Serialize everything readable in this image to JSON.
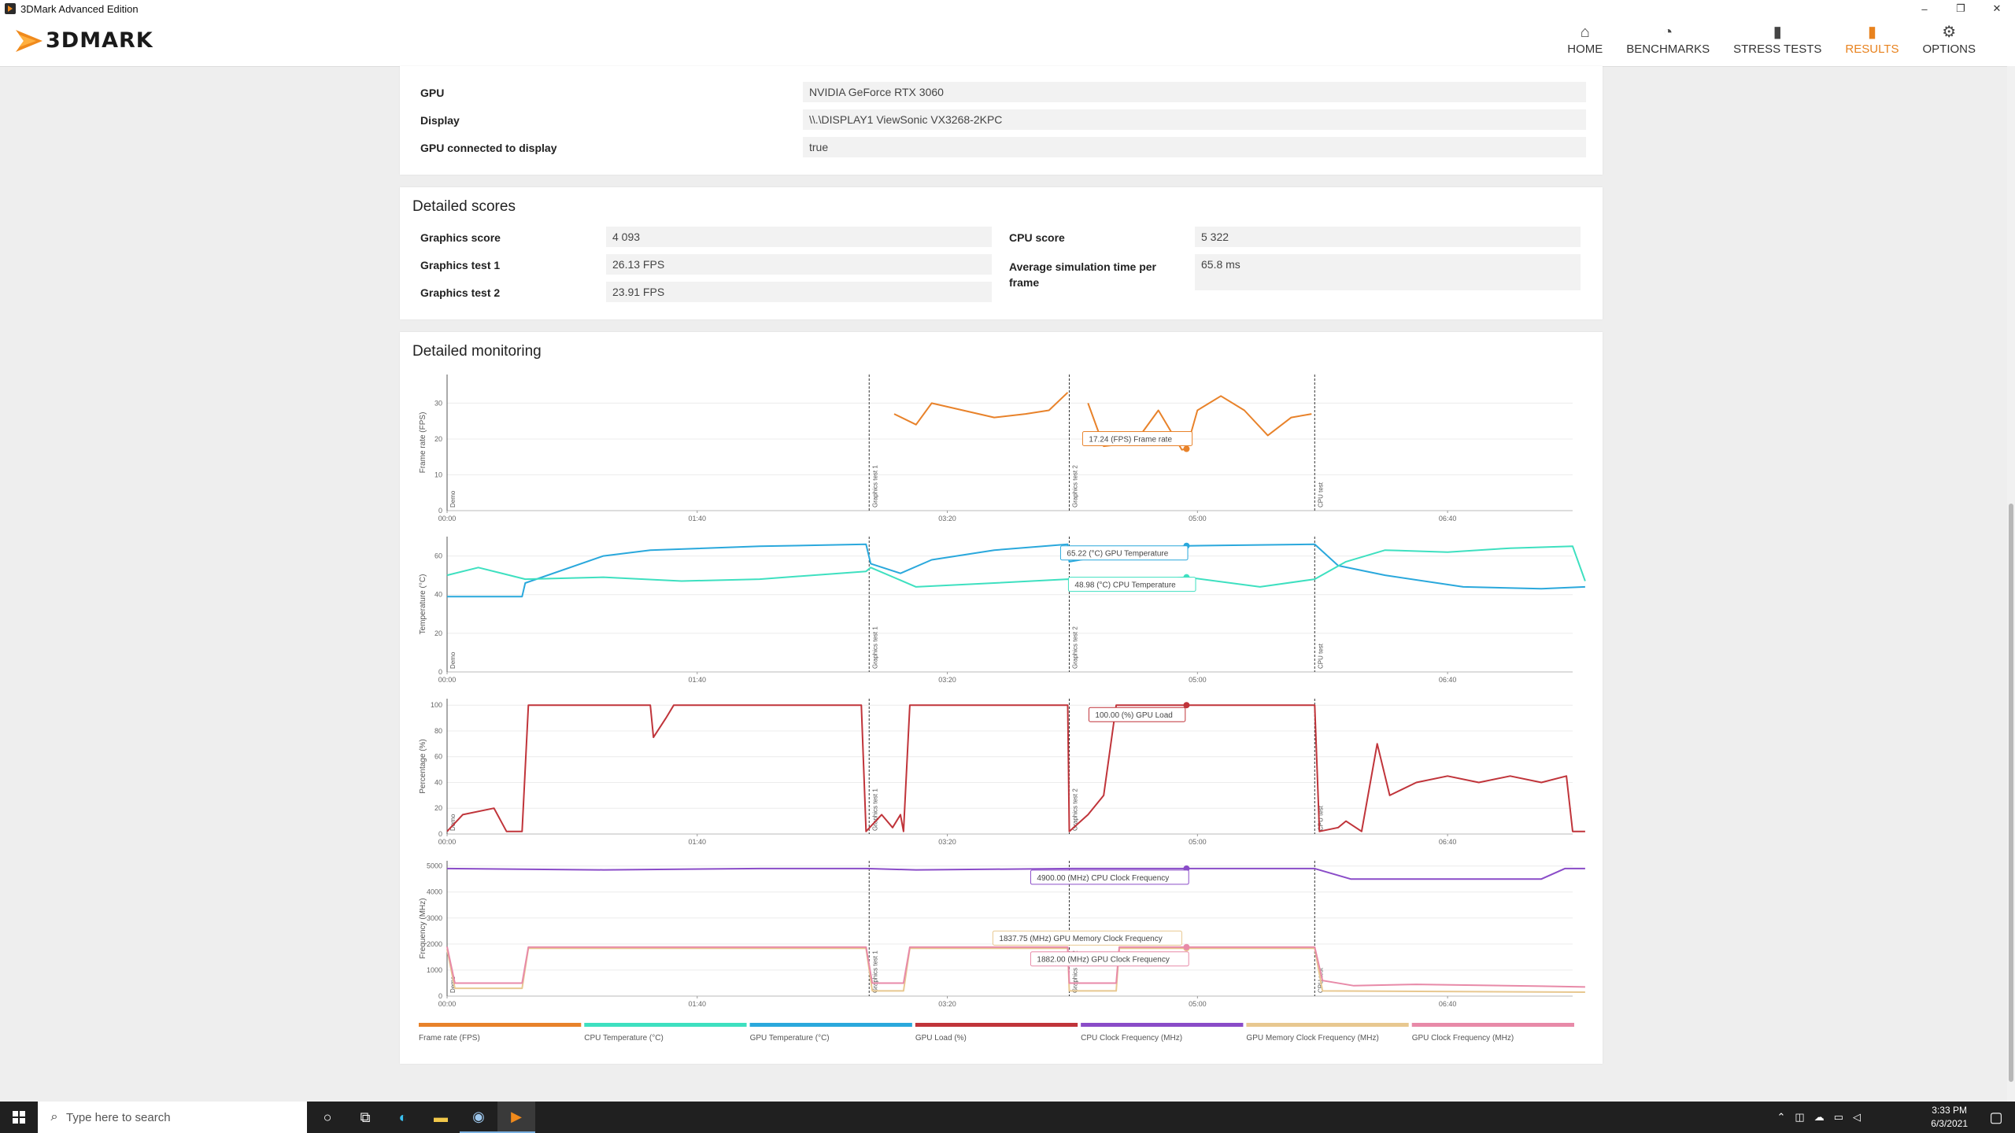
{
  "window": {
    "title": "3DMark Advanced Edition",
    "minimize": "–",
    "maximize": "❐",
    "close": "✕"
  },
  "brand": {
    "name": "3DMARK",
    "accent": "#f08a1c"
  },
  "nav": [
    {
      "label": "HOME",
      "icon": "home-icon",
      "glyph": "⌂"
    },
    {
      "label": "BENCHMARKS",
      "icon": "gauge-icon",
      "glyph": "◔"
    },
    {
      "label": "STRESS TESTS",
      "icon": "bars-icon",
      "glyph": "▮"
    },
    {
      "label": "RESULTS",
      "icon": "chart-icon",
      "glyph": "▮"
    },
    {
      "label": "OPTIONS",
      "icon": "gear-icon",
      "glyph": "⚙"
    }
  ],
  "system_info": [
    {
      "label": "GPU",
      "value": "NVIDIA GeForce RTX 3060"
    },
    {
      "label": "Display",
      "value": "\\\\.\\DISPLAY1 ViewSonic VX3268-2KPC"
    },
    {
      "label": "GPU connected to display",
      "value": "true"
    }
  ],
  "scores": {
    "title": "Detailed scores",
    "left": [
      {
        "label": "Graphics score",
        "value": "4 093"
      },
      {
        "label": "Graphics test 1",
        "value": "26.13 FPS"
      },
      {
        "label": "Graphics test 2",
        "value": "23.91 FPS"
      }
    ],
    "right": [
      {
        "label": "CPU score",
        "value": "5 322"
      },
      {
        "label": "Average simulation time per frame",
        "value": "65.8 ms"
      }
    ]
  },
  "monitoring": {
    "title": "Detailed monitoring",
    "time_ticks": [
      "00:00",
      "01:40",
      "03:20",
      "05:00",
      "06:40"
    ],
    "phases": [
      {
        "label": "Demo",
        "start": 0
      },
      {
        "label": "Graphics test 1",
        "start": 270
      },
      {
        "label": "Graphics test 2",
        "start": 398
      },
      {
        "label": "CPU test",
        "start": 555
      }
    ],
    "panels": [
      {
        "ylabel": "Frame rate (FPS)",
        "ymax": 38,
        "ticks": [
          "0",
          "10",
          "20",
          "30"
        ]
      },
      {
        "ylabel": "Temperature (°C)",
        "ymax": 70,
        "ticks": [
          "0",
          "20",
          "40",
          "60"
        ]
      },
      {
        "ylabel": "Percentage (%)",
        "ymax": 105,
        "ticks": [
          "0",
          "20",
          "40",
          "60",
          "80",
          "100"
        ]
      },
      {
        "ylabel": "Frequency (MHz)",
        "ymax": 5200,
        "ticks": [
          "0",
          "1000",
          "2000",
          "3000",
          "4000",
          "5000"
        ]
      }
    ],
    "tooltips": [
      "17.24 (FPS) Frame rate",
      "65.22 (°C) GPU Temperature",
      "48.98 (°C) CPU Temperature",
      "100.00 (%) GPU Load",
      "4900.00 (MHz) CPU Clock Frequency",
      "1837.75 (MHz) GPU Memory Clock Frequency",
      "1882.00 (MHz) GPU Clock Frequency"
    ],
    "legend": [
      {
        "label": "Frame rate (FPS)",
        "color": "#e8822a"
      },
      {
        "label": "CPU Temperature (°C)",
        "color": "#3ee0c0"
      },
      {
        "label": "GPU Temperature (°C)",
        "color": "#2aa8dc"
      },
      {
        "label": "GPU Load (%)",
        "color": "#c0343a"
      },
      {
        "label": "CPU Clock Frequency (MHz)",
        "color": "#8a4cc8"
      },
      {
        "label": "GPU Memory Clock Frequency (MHz)",
        "color": "#e8c890"
      },
      {
        "label": "GPU Clock Frequency (MHz)",
        "color": "#e88aa8"
      }
    ]
  },
  "chart_data": {
    "type": "line",
    "x_unit": "seconds",
    "x_range": [
      0,
      720
    ],
    "cursor_x": 473,
    "frame_rate": [
      [
        286,
        27
      ],
      [
        300,
        24
      ],
      [
        310,
        30
      ],
      [
        330,
        28
      ],
      [
        350,
        26
      ],
      [
        370,
        27
      ],
      [
        385,
        28
      ],
      [
        397,
        33
      ],
      [
        398,
        null
      ],
      [
        410,
        30
      ],
      [
        420,
        18
      ],
      [
        440,
        19
      ],
      [
        455,
        28
      ],
      [
        470,
        17
      ],
      [
        473,
        17.24
      ],
      [
        480,
        28
      ],
      [
        495,
        32
      ],
      [
        510,
        28
      ],
      [
        525,
        21
      ],
      [
        540,
        26
      ],
      [
        553,
        27
      ]
    ],
    "gpu_temperature": [
      [
        0,
        39
      ],
      [
        48,
        39
      ],
      [
        50,
        46
      ],
      [
        100,
        60
      ],
      [
        130,
        63
      ],
      [
        200,
        65
      ],
      [
        268,
        66
      ],
      [
        271,
        56
      ],
      [
        290,
        51
      ],
      [
        310,
        58
      ],
      [
        350,
        63
      ],
      [
        397,
        66
      ],
      [
        398,
        57
      ],
      [
        420,
        60
      ],
      [
        473,
        65.22
      ],
      [
        555,
        66
      ],
      [
        570,
        55
      ],
      [
        600,
        50
      ],
      [
        650,
        44
      ],
      [
        700,
        43
      ],
      [
        728,
        44
      ]
    ],
    "cpu_temperature": [
      [
        0,
        50
      ],
      [
        20,
        54
      ],
      [
        50,
        48
      ],
      [
        100,
        49
      ],
      [
        150,
        47
      ],
      [
        200,
        48
      ],
      [
        268,
        52
      ],
      [
        271,
        54
      ],
      [
        300,
        44
      ],
      [
        350,
        46
      ],
      [
        397,
        48
      ],
      [
        420,
        46
      ],
      [
        473,
        48.98
      ],
      [
        520,
        44
      ],
      [
        555,
        48
      ],
      [
        575,
        57
      ],
      [
        600,
        63
      ],
      [
        640,
        62
      ],
      [
        680,
        64
      ],
      [
        720,
        65
      ],
      [
        728,
        47
      ]
    ],
    "gpu_load": [
      [
        0,
        2
      ],
      [
        10,
        15
      ],
      [
        30,
        20
      ],
      [
        38,
        2
      ],
      [
        48,
        2
      ],
      [
        52,
        100
      ],
      [
        130,
        100
      ],
      [
        132,
        75
      ],
      [
        140,
        90
      ],
      [
        145,
        100
      ],
      [
        265,
        100
      ],
      [
        268,
        2
      ],
      [
        278,
        15
      ],
      [
        285,
        5
      ],
      [
        290,
        15
      ],
      [
        292,
        2
      ],
      [
        296,
        100
      ],
      [
        397,
        100
      ],
      [
        398,
        2
      ],
      [
        410,
        15
      ],
      [
        420,
        30
      ],
      [
        428,
        100
      ],
      [
        555,
        100
      ],
      [
        558,
        2
      ],
      [
        570,
        5
      ],
      [
        575,
        10
      ],
      [
        585,
        2
      ],
      [
        595,
        70
      ],
      [
        603,
        30
      ],
      [
        620,
        40
      ],
      [
        640,
        45
      ],
      [
        660,
        40
      ],
      [
        680,
        45
      ],
      [
        700,
        40
      ],
      [
        716,
        45
      ],
      [
        720,
        2
      ],
      [
        728,
        2
      ]
    ],
    "cpu_clock": [
      [
        0,
        4900
      ],
      [
        100,
        4850
      ],
      [
        200,
        4900
      ],
      [
        268,
        4900
      ],
      [
        300,
        4850
      ],
      [
        400,
        4900
      ],
      [
        473,
        4900
      ],
      [
        555,
        4900
      ],
      [
        578,
        4500
      ],
      [
        700,
        4500
      ],
      [
        715,
        4900
      ],
      [
        728,
        4900
      ]
    ],
    "gpu_mem_clock": [
      [
        0,
        1800
      ],
      [
        5,
        300
      ],
      [
        48,
        300
      ],
      [
        52,
        1837
      ],
      [
        268,
        1837
      ],
      [
        272,
        200
      ],
      [
        292,
        200
      ],
      [
        296,
        1837
      ],
      [
        397,
        1837
      ],
      [
        398,
        200
      ],
      [
        428,
        200
      ],
      [
        430,
        1837
      ],
      [
        473,
        1837.75
      ],
      [
        555,
        1837
      ],
      [
        560,
        200
      ],
      [
        728,
        150
      ]
    ],
    "gpu_clock": [
      [
        0,
        1900
      ],
      [
        5,
        500
      ],
      [
        48,
        500
      ],
      [
        52,
        1882
      ],
      [
        268,
        1882
      ],
      [
        272,
        500
      ],
      [
        292,
        500
      ],
      [
        296,
        1882
      ],
      [
        397,
        1882
      ],
      [
        398,
        500
      ],
      [
        428,
        500
      ],
      [
        430,
        1882
      ],
      [
        473,
        1882
      ],
      [
        555,
        1882
      ],
      [
        560,
        600
      ],
      [
        580,
        400
      ],
      [
        620,
        450
      ],
      [
        700,
        380
      ],
      [
        728,
        350
      ]
    ]
  },
  "taskbar": {
    "search_placeholder": "Type here to search",
    "time": "3:33 PM",
    "date": "6/3/2021"
  }
}
